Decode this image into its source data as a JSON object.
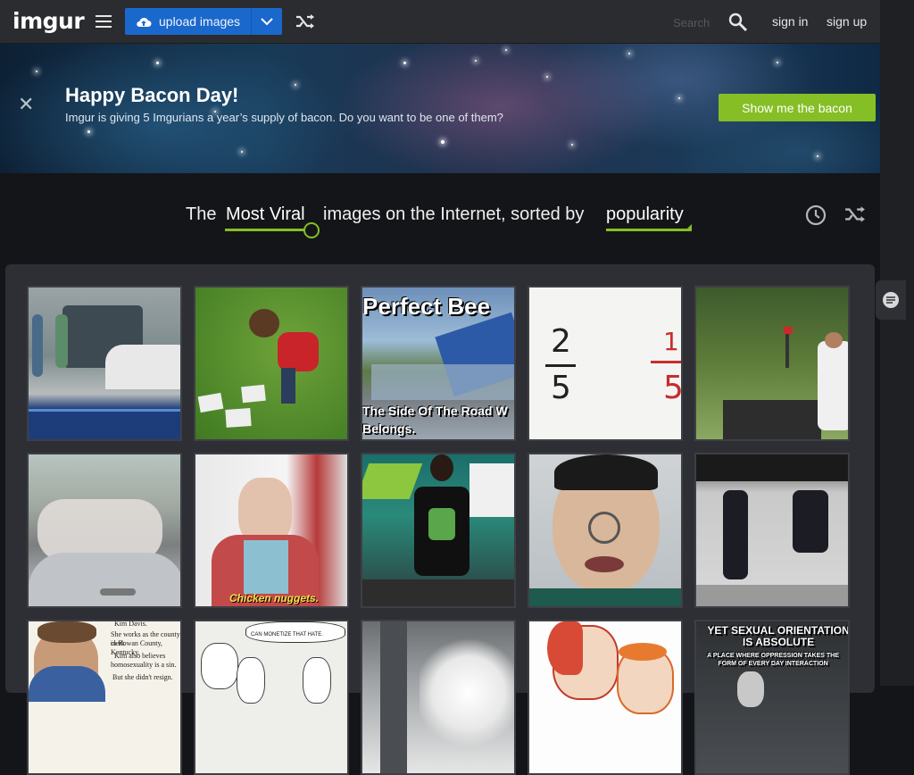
{
  "header": {
    "logo": "imgur",
    "upload_label": "upload images",
    "search_placeholder": "Search",
    "sign_in": "sign in",
    "sign_up": "sign up"
  },
  "banner": {
    "title": "Happy Bacon Day!",
    "subtitle": "Imgur is giving 5 Imgurians a year’s supply of bacon. Do you want to be one of them?",
    "button": "Show me the bacon"
  },
  "sort": {
    "prefix": "The",
    "section": "Most Viral",
    "middle": "images on the Internet, sorted by",
    "order": "popularity"
  },
  "thumbnails": [
    {
      "caption": ""
    },
    {
      "caption": ""
    },
    {
      "caption": "Perfect Bee"
    },
    {
      "caption": ""
    },
    {
      "caption": ""
    },
    {
      "caption": ""
    },
    {
      "caption": "Chicken nuggets."
    },
    {
      "caption": ""
    },
    {
      "caption": ""
    },
    {
      "caption": ""
    },
    {
      "caption": ""
    },
    {
      "caption": ""
    },
    {
      "caption": ""
    },
    {
      "caption": ""
    },
    {
      "caption": "YET SEXUAL ORIENTATION IS ABSOLUTE"
    }
  ],
  "thumb_text": {
    "beer_line1": "The Side Of The Road W",
    "beer_line2": "Belongs.",
    "fraction_left_top": "2",
    "fraction_left_bottom": "5",
    "fraction_right_top": "1",
    "fraction_right_bottom": "5",
    "clerk_line1": "She works as the county clerk",
    "clerk_line2": "in Rowan County, Kentucky.",
    "clerk_line3": "Kim also believes",
    "clerk_line4": "homosexuality is a sin.",
    "clerk_line5": "But she didn't resign.",
    "clerk_name": "Kim Davis.",
    "comic_bubble": "CAN MONETIZE THAT HATE.",
    "orientation_sub": "A PLACE WHERE OPPRESSION TAKES THE FORM OF EVERY DAY INTERACTION"
  },
  "colors": {
    "topbar": "#2b2c30",
    "upload": "#1b68cc",
    "accent_green": "#85bf25",
    "page_bg": "#141518",
    "gallery_bg": "#2e2f35"
  }
}
